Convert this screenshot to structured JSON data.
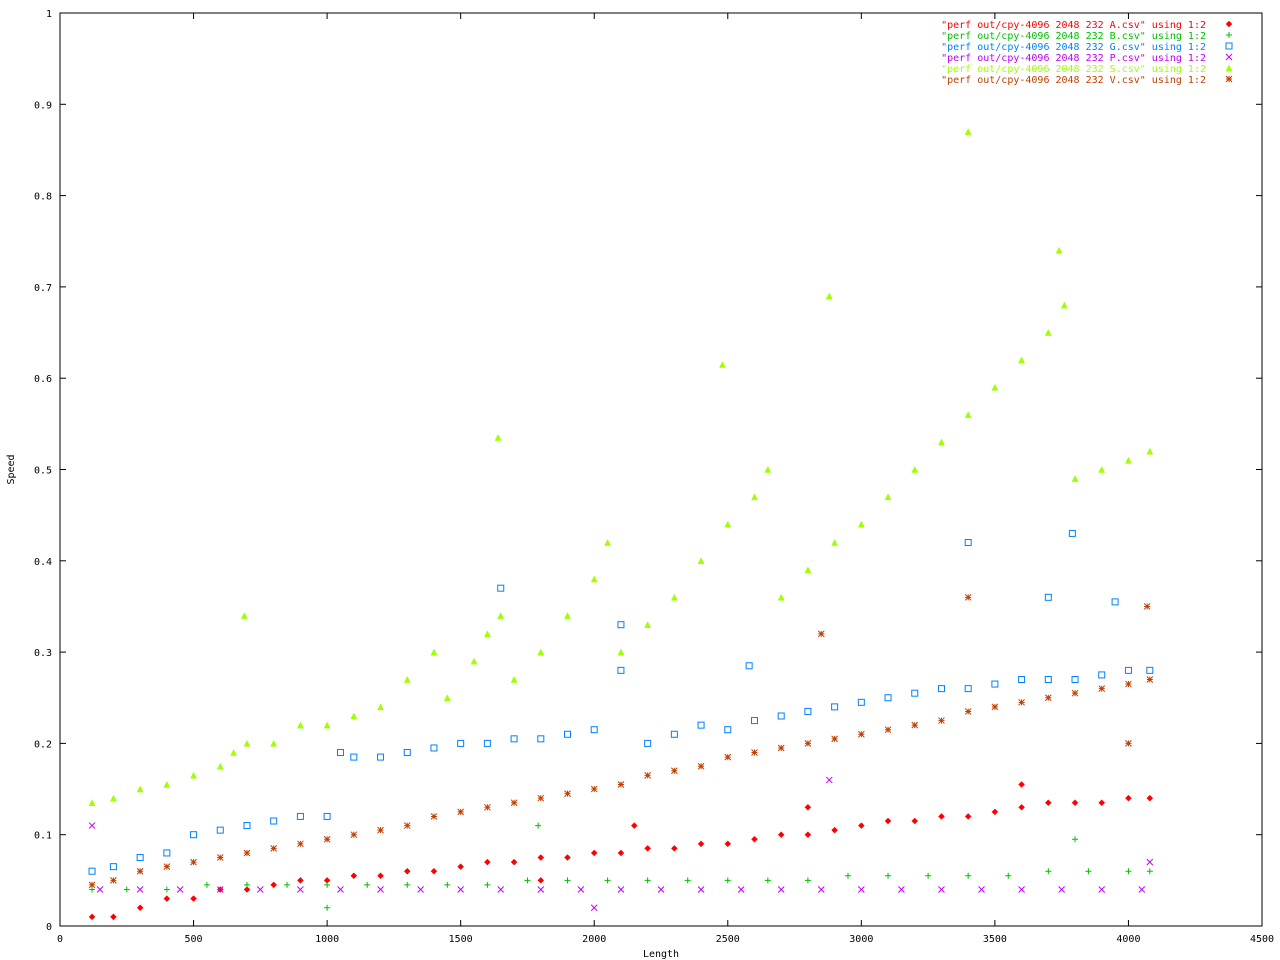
{
  "chart_data": {
    "type": "scatter",
    "title": "",
    "xlabel": "Length",
    "ylabel": "Speed",
    "xlim": [
      0,
      4500
    ],
    "ylim": [
      0,
      1
    ],
    "xticks": [
      "0",
      "500",
      "1000",
      "1500",
      "2000",
      "2500",
      "3000",
      "3500",
      "4000",
      "4500"
    ],
    "yticks": [
      "0",
      "0.1",
      "0.2",
      "0.3",
      "0.4",
      "0.5",
      "0.6",
      "0.7",
      "0.8",
      "0.9",
      "1"
    ],
    "grid": false,
    "legend_position": "top-right",
    "series": [
      {
        "name": "\"perf out/cpy-4096 2048 232 A.csv\" using 1:2",
        "color": "#ff0000",
        "marker": "diamond",
        "points": [
          [
            120,
            0.01
          ],
          [
            200,
            0.01
          ],
          [
            300,
            0.02
          ],
          [
            400,
            0.03
          ],
          [
            500,
            0.03
          ],
          [
            600,
            0.04
          ],
          [
            700,
            0.04
          ],
          [
            800,
            0.045
          ],
          [
            900,
            0.05
          ],
          [
            1000,
            0.05
          ],
          [
            1100,
            0.055
          ],
          [
            1200,
            0.055
          ],
          [
            1300,
            0.06
          ],
          [
            1400,
            0.06
          ],
          [
            1500,
            0.065
          ],
          [
            1600,
            0.07
          ],
          [
            1700,
            0.07
          ],
          [
            1800,
            0.075
          ],
          [
            1900,
            0.075
          ],
          [
            2000,
            0.08
          ],
          [
            2100,
            0.08
          ],
          [
            2200,
            0.085
          ],
          [
            2300,
            0.085
          ],
          [
            2400,
            0.09
          ],
          [
            2500,
            0.09
          ],
          [
            2600,
            0.095
          ],
          [
            2700,
            0.1
          ],
          [
            2800,
            0.1
          ],
          [
            2900,
            0.105
          ],
          [
            3000,
            0.11
          ],
          [
            3100,
            0.115
          ],
          [
            3200,
            0.115
          ],
          [
            3300,
            0.12
          ],
          [
            3400,
            0.12
          ],
          [
            3500,
            0.125
          ],
          [
            3600,
            0.13
          ],
          [
            3700,
            0.135
          ],
          [
            3800,
            0.135
          ],
          [
            3900,
            0.135
          ],
          [
            4000,
            0.14
          ],
          [
            4080,
            0.14
          ],
          [
            1800,
            0.05
          ],
          [
            2150,
            0.11
          ],
          [
            2800,
            0.13
          ],
          [
            3600,
            0.155
          ]
        ]
      },
      {
        "name": "\"perf out/cpy-4096 2048 232 B.csv\" using 1:2",
        "color": "#00c000",
        "marker": "plus",
        "points": [
          [
            120,
            0.04
          ],
          [
            250,
            0.04
          ],
          [
            400,
            0.04
          ],
          [
            550,
            0.045
          ],
          [
            700,
            0.045
          ],
          [
            850,
            0.045
          ],
          [
            1000,
            0.045
          ],
          [
            1150,
            0.045
          ],
          [
            1300,
            0.045
          ],
          [
            1450,
            0.045
          ],
          [
            1600,
            0.045
          ],
          [
            1750,
            0.05
          ],
          [
            1900,
            0.05
          ],
          [
            2050,
            0.05
          ],
          [
            2200,
            0.05
          ],
          [
            2350,
            0.05
          ],
          [
            2500,
            0.05
          ],
          [
            2650,
            0.05
          ],
          [
            2800,
            0.05
          ],
          [
            2950,
            0.055
          ],
          [
            3100,
            0.055
          ],
          [
            3250,
            0.055
          ],
          [
            3400,
            0.055
          ],
          [
            3550,
            0.055
          ],
          [
            3700,
            0.06
          ],
          [
            3850,
            0.06
          ],
          [
            4000,
            0.06
          ],
          [
            4080,
            0.06
          ],
          [
            1790,
            0.11
          ],
          [
            3800,
            0.095
          ],
          [
            1000,
            0.02
          ]
        ]
      },
      {
        "name": "\"perf out/cpy-4096 2048 232 G.csv\" using 1:2",
        "color": "#0080ff",
        "marker": "square",
        "points": [
          [
            120,
            0.06
          ],
          [
            200,
            0.065
          ],
          [
            300,
            0.075
          ],
          [
            400,
            0.08
          ],
          [
            500,
            0.1
          ],
          [
            600,
            0.105
          ],
          [
            700,
            0.11
          ],
          [
            800,
            0.115
          ],
          [
            900,
            0.12
          ],
          [
            1000,
            0.12
          ],
          [
            1050,
            0.19
          ],
          [
            1100,
            0.185
          ],
          [
            1200,
            0.185
          ],
          [
            1300,
            0.19
          ],
          [
            1400,
            0.195
          ],
          [
            1500,
            0.2
          ],
          [
            1600,
            0.2
          ],
          [
            1700,
            0.205
          ],
          [
            1800,
            0.205
          ],
          [
            1900,
            0.21
          ],
          [
            2000,
            0.215
          ],
          [
            2100,
            0.28
          ],
          [
            2200,
            0.2
          ],
          [
            2300,
            0.21
          ],
          [
            2400,
            0.22
          ],
          [
            2500,
            0.215
          ],
          [
            2600,
            0.225
          ],
          [
            2700,
            0.23
          ],
          [
            2800,
            0.235
          ],
          [
            2900,
            0.24
          ],
          [
            3000,
            0.245
          ],
          [
            3100,
            0.25
          ],
          [
            3200,
            0.255
          ],
          [
            3300,
            0.26
          ],
          [
            3400,
            0.26
          ],
          [
            3500,
            0.265
          ],
          [
            3600,
            0.27
          ],
          [
            3700,
            0.27
          ],
          [
            3800,
            0.27
          ],
          [
            3900,
            0.275
          ],
          [
            4000,
            0.28
          ],
          [
            4080,
            0.28
          ],
          [
            3400,
            0.42
          ],
          [
            3790,
            0.43
          ],
          [
            2580,
            0.285
          ],
          [
            2100,
            0.33
          ],
          [
            1650,
            0.37
          ],
          [
            3700,
            0.36
          ],
          [
            3950,
            0.355
          ]
        ]
      },
      {
        "name": "\"perf out/cpy-4096 2048 232 P.csv\" using 1:2",
        "color": "#c000ff",
        "marker": "x",
        "points": [
          [
            120,
            0.11
          ],
          [
            150,
            0.04
          ],
          [
            300,
            0.04
          ],
          [
            450,
            0.04
          ],
          [
            600,
            0.04
          ],
          [
            750,
            0.04
          ],
          [
            900,
            0.04
          ],
          [
            1050,
            0.04
          ],
          [
            1200,
            0.04
          ],
          [
            1350,
            0.04
          ],
          [
            1500,
            0.04
          ],
          [
            1650,
            0.04
          ],
          [
            1800,
            0.04
          ],
          [
            1950,
            0.04
          ],
          [
            2100,
            0.04
          ],
          [
            2250,
            0.04
          ],
          [
            2400,
            0.04
          ],
          [
            2550,
            0.04
          ],
          [
            2700,
            0.04
          ],
          [
            2850,
            0.04
          ],
          [
            3000,
            0.04
          ],
          [
            3150,
            0.04
          ],
          [
            3300,
            0.04
          ],
          [
            3450,
            0.04
          ],
          [
            3600,
            0.04
          ],
          [
            3750,
            0.04
          ],
          [
            3900,
            0.04
          ],
          [
            4050,
            0.04
          ],
          [
            2880,
            0.16
          ],
          [
            2000,
            0.02
          ],
          [
            4080,
            0.07
          ]
        ]
      },
      {
        "name": "\"perf out/cpy-4096 2048 232 S.csv\" using 1:2",
        "color": "#a0ff00",
        "marker": "triangle",
        "points": [
          [
            120,
            0.135
          ],
          [
            200,
            0.14
          ],
          [
            300,
            0.15
          ],
          [
            400,
            0.155
          ],
          [
            500,
            0.165
          ],
          [
            600,
            0.175
          ],
          [
            650,
            0.19
          ],
          [
            700,
            0.2
          ],
          [
            800,
            0.2
          ],
          [
            900,
            0.22
          ],
          [
            1000,
            0.22
          ],
          [
            1100,
            0.23
          ],
          [
            1200,
            0.24
          ],
          [
            1300,
            0.27
          ],
          [
            1400,
            0.3
          ],
          [
            1450,
            0.25
          ],
          [
            1550,
            0.29
          ],
          [
            1600,
            0.32
          ],
          [
            1650,
            0.34
          ],
          [
            1700,
            0.27
          ],
          [
            1800,
            0.3
          ],
          [
            1900,
            0.34
          ],
          [
            2000,
            0.38
          ],
          [
            2050,
            0.42
          ],
          [
            2100,
            0.3
          ],
          [
            2200,
            0.33
          ],
          [
            2300,
            0.36
          ],
          [
            2400,
            0.4
          ],
          [
            2500,
            0.44
          ],
          [
            2600,
            0.47
          ],
          [
            2650,
            0.5
          ],
          [
            2700,
            0.36
          ],
          [
            2800,
            0.39
          ],
          [
            2900,
            0.42
          ],
          [
            3000,
            0.44
          ],
          [
            3100,
            0.47
          ],
          [
            3200,
            0.5
          ],
          [
            3300,
            0.53
          ],
          [
            3400,
            0.56
          ],
          [
            3500,
            0.59
          ],
          [
            3600,
            0.62
          ],
          [
            3700,
            0.65
          ],
          [
            3760,
            0.68
          ],
          [
            3800,
            0.49
          ],
          [
            3900,
            0.5
          ],
          [
            4000,
            0.51
          ],
          [
            4080,
            0.52
          ],
          [
            3400,
            0.87
          ],
          [
            2880,
            0.69
          ],
          [
            3740,
            0.74
          ],
          [
            690,
            0.34
          ],
          [
            1640,
            0.535
          ],
          [
            2480,
            0.615
          ]
        ]
      },
      {
        "name": "\"perf out/cpy-4096 2048 232 V.csv\" using 1:2",
        "color": "#c04000",
        "marker": "star",
        "points": [
          [
            120,
            0.045
          ],
          [
            200,
            0.05
          ],
          [
            300,
            0.06
          ],
          [
            400,
            0.065
          ],
          [
            500,
            0.07
          ],
          [
            600,
            0.075
          ],
          [
            700,
            0.08
          ],
          [
            800,
            0.085
          ],
          [
            900,
            0.09
          ],
          [
            1000,
            0.095
          ],
          [
            1100,
            0.1
          ],
          [
            1200,
            0.105
          ],
          [
            1300,
            0.11
          ],
          [
            1400,
            0.12
          ],
          [
            1500,
            0.125
          ],
          [
            1600,
            0.13
          ],
          [
            1700,
            0.135
          ],
          [
            1800,
            0.14
          ],
          [
            1900,
            0.145
          ],
          [
            2000,
            0.15
          ],
          [
            2100,
            0.155
          ],
          [
            2200,
            0.165
          ],
          [
            2300,
            0.17
          ],
          [
            2400,
            0.175
          ],
          [
            2500,
            0.185
          ],
          [
            2600,
            0.19
          ],
          [
            2700,
            0.195
          ],
          [
            2800,
            0.2
          ],
          [
            2900,
            0.205
          ],
          [
            3000,
            0.21
          ],
          [
            3100,
            0.215
          ],
          [
            3200,
            0.22
          ],
          [
            3300,
            0.225
          ],
          [
            3400,
            0.235
          ],
          [
            3500,
            0.24
          ],
          [
            3600,
            0.245
          ],
          [
            3700,
            0.25
          ],
          [
            3800,
            0.255
          ],
          [
            3900,
            0.26
          ],
          [
            4000,
            0.265
          ],
          [
            4080,
            0.27
          ],
          [
            3400,
            0.36
          ],
          [
            4070,
            0.35
          ],
          [
            4000,
            0.2
          ],
          [
            2850,
            0.32
          ]
        ]
      }
    ]
  }
}
